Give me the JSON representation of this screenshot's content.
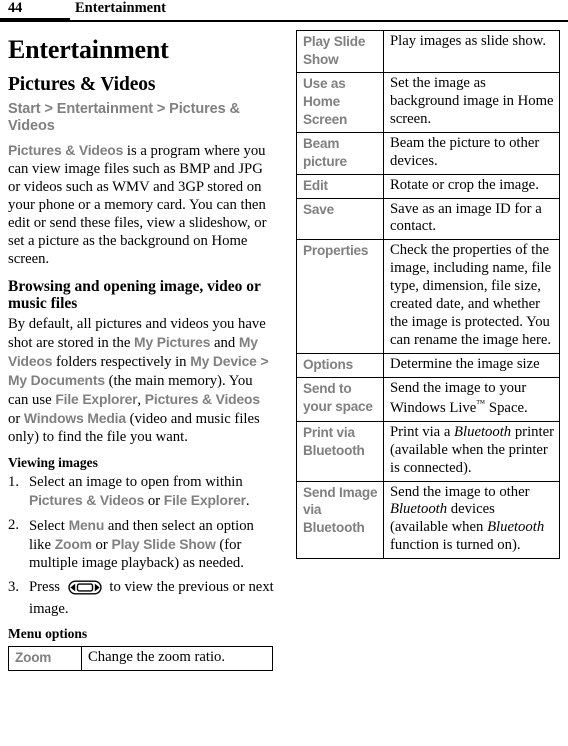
{
  "header": {
    "page_number": "44",
    "running_title": "Entertainment"
  },
  "left_column": {
    "chapter_title": "Entertainment",
    "section_title": "Pictures & Videos",
    "breadcrumb": "Start > Entertainment > Pictures & Videos",
    "intro_paragraph": {
      "lead_ui_term": "Pictures & Videos",
      "rest": " is a program where you can view image files such as BMP and JPG or videos such as WMV and 3GP stored on your phone or a memory card. You can then edit or send these files, view a slideshow, or set a picture as the background on Home screen."
    },
    "subsection_title": "Browsing and opening image, video or music files",
    "browsing_paragraph": {
      "p1": "By default, all pictures and videos you have shot are stored in the ",
      "ui1": "My Pictures",
      "p2": " and ",
      "ui2": "My Videos",
      "p3": " folders respectively in ",
      "ui3": "My Device",
      "p4": " > ",
      "ui4": "My Documents",
      "p5": " (the main memory). You can use ",
      "ui5": "File Explorer",
      "p6": ", ",
      "ui6": "Pictures & Videos",
      "p7": " or ",
      "ui7": "Windows Media",
      "p8": " (video and music files only) to find the file you want."
    },
    "viewing_title": "Viewing images",
    "steps": [
      {
        "p1": "Select an image to open from within ",
        "ui1": "Pictures & Videos",
        "p2": " or ",
        "ui2": "File Explorer",
        "p3": "."
      },
      {
        "p1": "Select ",
        "ui1": "Menu",
        "p2": " and then select an option like ",
        "ui2": "Zoom",
        "p3": " or ",
        "ui3": "Play Slide Show",
        "p4": " (for multiple image playback) as needed."
      },
      {
        "p1": "Press ",
        "icon": "navigation-key-left-right-icon",
        "p2": " to view the previous or next image."
      }
    ],
    "menu_options_title": "Menu options",
    "menu_table": {
      "rows": [
        {
          "key": "Zoom",
          "value": "Change the zoom ratio."
        }
      ]
    }
  },
  "right_column": {
    "menu_table": {
      "rows": [
        {
          "key": "Play Slide Show",
          "value": "Play images as slide show."
        },
        {
          "key": "Use as Home Screen",
          "value": "Set the image as background image in Home screen."
        },
        {
          "key": "Beam picture",
          "value": "Beam the picture to other devices."
        },
        {
          "key": "Edit",
          "value": "Rotate or crop the image."
        },
        {
          "key": "Save",
          "value": "Save as an image ID for a contact."
        },
        {
          "key": "Properties",
          "value": "Check the properties of the image, including name, file type, dimension, file size, created date, and whether the image is protected. You can rename the image here."
        },
        {
          "key": "Options",
          "value": "Determine the image size"
        },
        {
          "key": "Send to your space",
          "value_p1": "Send the image to your Windows Live",
          "value_tm": "™",
          "value_p2": " Space."
        },
        {
          "key": "Print via Bluetooth",
          "value_p1": "Print via a ",
          "value_em1": "Bluetooth",
          "value_p2": " printer (available when the printer is connected)."
        },
        {
          "key": "Send Image via Bluetooth",
          "value_p1": "Send the image to other ",
          "value_em1": "Bluetooth",
          "value_p2": " devices (available when ",
          "value_em2": "Bluetooth",
          "value_p3": " function is turned on)."
        }
      ]
    }
  },
  "colors": {
    "ui_term_gray": "#808080",
    "text_black": "#000000",
    "page_background": "#ffffff"
  }
}
